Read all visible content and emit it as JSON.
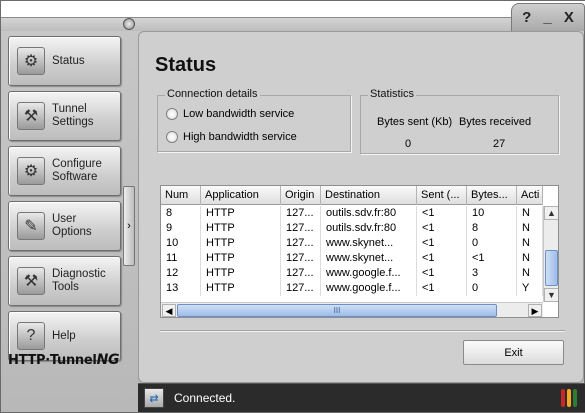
{
  "window": {
    "controls": {
      "help": "?",
      "minimize": "_",
      "close": "X"
    }
  },
  "sidebar": {
    "items": [
      {
        "label": "Status",
        "icon": "status-icon",
        "glyph": "⚙"
      },
      {
        "label": "Tunnel\nSettings",
        "icon": "tunnel-settings-icon",
        "glyph": "⚒"
      },
      {
        "label": "Configure\nSoftware",
        "icon": "configure-software-icon",
        "glyph": "⚙"
      },
      {
        "label": "User\nOptions",
        "icon": "user-options-icon",
        "glyph": "✎"
      },
      {
        "label": "Diagnostic\nTools",
        "icon": "diagnostic-tools-icon",
        "glyph": "⚒"
      },
      {
        "label": "Help",
        "icon": "help-icon",
        "glyph": "?"
      }
    ],
    "collapse_glyph": "›",
    "logo": {
      "part1": "HTTP·Tunnel",
      "part2": "NG"
    }
  },
  "main": {
    "title": "Status",
    "connection": {
      "legend": "Connection details",
      "options": [
        "Low bandwidth service",
        "High bandwidth service"
      ]
    },
    "statistics": {
      "legend": "Statistics",
      "sent_label": "Bytes sent (Kb)",
      "received_label": "Bytes received",
      "sent_value": "0",
      "received_value": "27"
    },
    "table": {
      "headers": [
        "Num",
        "Application",
        "Origin",
        "Destination",
        "Sent (...",
        "Bytes...",
        "Acti"
      ],
      "rows": [
        [
          "8",
          "HTTP",
          "127...",
          "outils.sdv.fr:80",
          "<1",
          "10",
          "N"
        ],
        [
          "9",
          "HTTP",
          "127...",
          "outils.sdv.fr:80",
          "<1",
          "8",
          "N"
        ],
        [
          "10",
          "HTTP",
          "127...",
          "www.skynet...",
          "<1",
          "0",
          "N"
        ],
        [
          "11",
          "HTTP",
          "127...",
          "www.skynet...",
          "<1",
          "<1",
          "N"
        ],
        [
          "12",
          "HTTP",
          "127...",
          "www.google.f...",
          "<1",
          "3",
          "N"
        ],
        [
          "13",
          "HTTP",
          "127...",
          "www.google.f...",
          "<1",
          "0",
          "Y"
        ]
      ],
      "scroll": {
        "up": "▲",
        "down": "▼",
        "left": "◀",
        "right": "▶",
        "grip": "III"
      }
    },
    "exit_label": "Exit"
  },
  "statusbar": {
    "text": "Connected.",
    "icon": "connection-icon",
    "lights": [
      "#c62828",
      "#f9a825",
      "#2e7d32"
    ]
  }
}
